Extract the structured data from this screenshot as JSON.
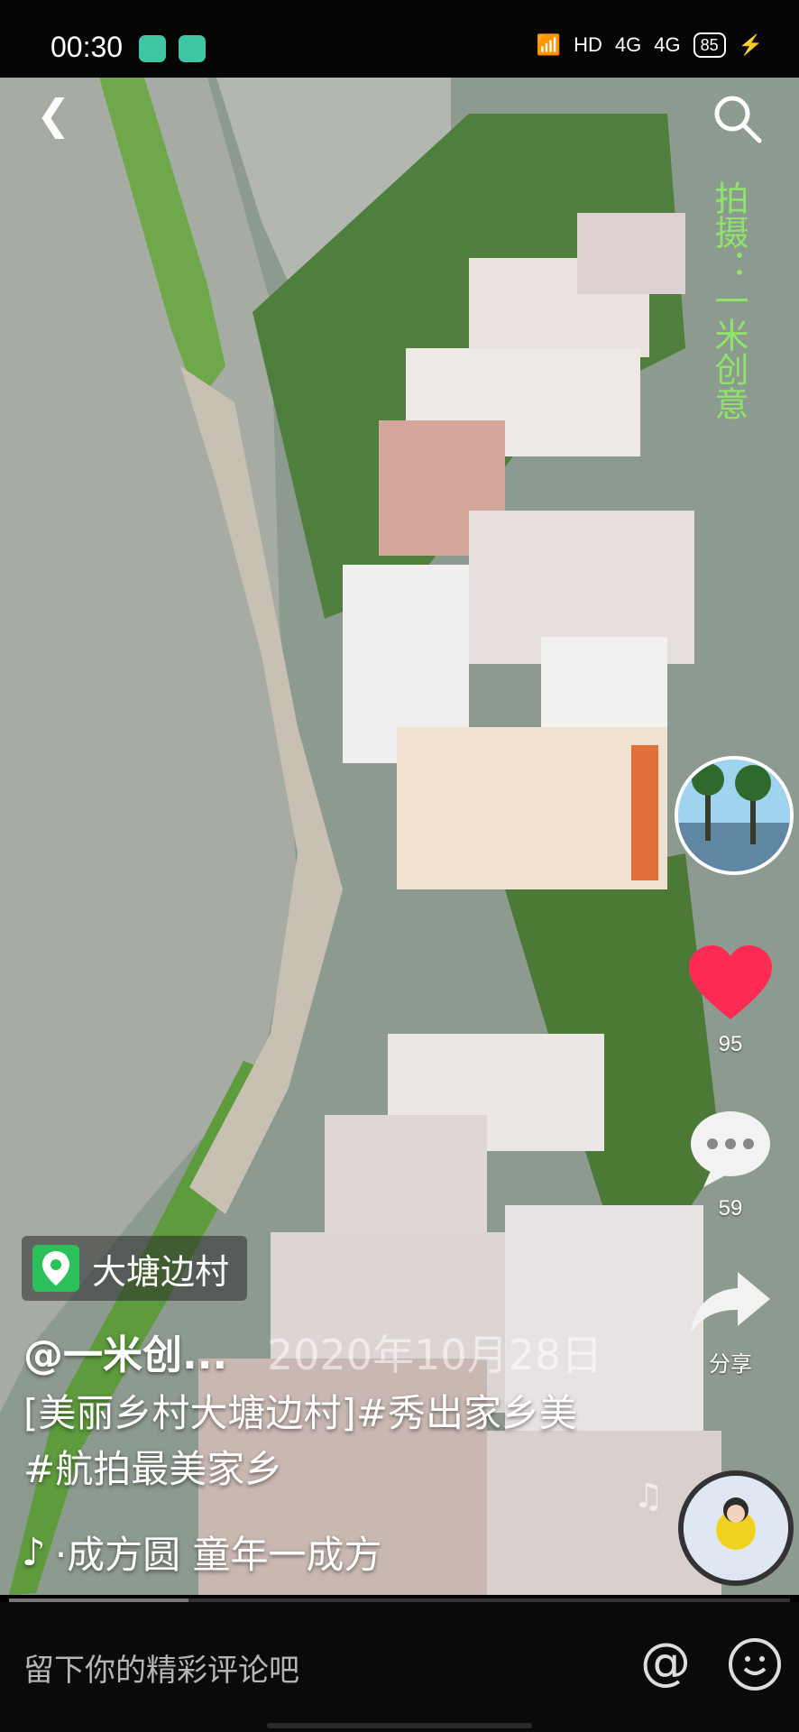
{
  "status_bar": {
    "time": "00:30",
    "network": "HD",
    "signal1": "4G",
    "signal2": "4G",
    "battery": "85"
  },
  "top": {
    "back_icon": "chevron-left-icon",
    "search_icon": "search-icon"
  },
  "watermark": "拍摄：一米创意",
  "actions": {
    "like_count": "95",
    "comment_count": "59",
    "share_label": "分享"
  },
  "location": "大塘边村",
  "author": "@一米创...",
  "date": "2020年10月28日",
  "description": "[美丽乡村大塘边村]#秀出家乡美 #航拍最美家乡",
  "music": "·成方圆   童年一成方",
  "comment_placeholder": "留下你的精彩评论吧",
  "progress": 0.23,
  "colors": {
    "like": "#ff2b54",
    "location_pin": "#2cc05a",
    "watermark": "#8fe36b"
  }
}
